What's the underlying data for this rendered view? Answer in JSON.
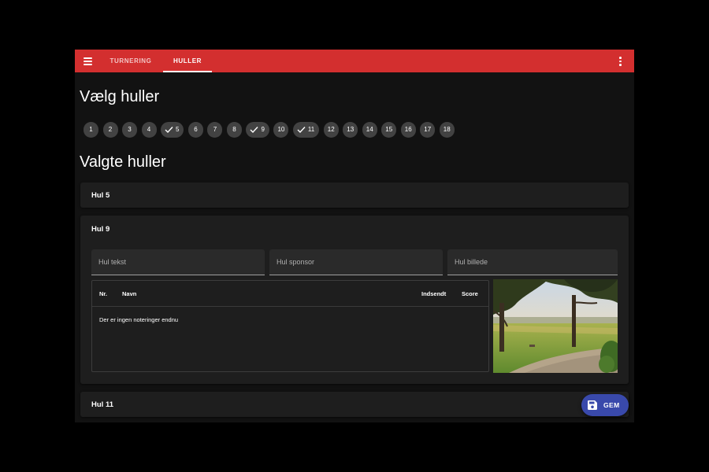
{
  "topbar": {
    "tabs": [
      {
        "label": "TURNERING",
        "active": false
      },
      {
        "label": "HULLER",
        "active": true
      }
    ],
    "menu_icon": "menu-icon",
    "more_icon": "more-vert-icon",
    "accent_color": "#d32f2f"
  },
  "select_section": {
    "title": "Vælg huller",
    "holes": [
      {
        "label": "1",
        "selected": false
      },
      {
        "label": "2",
        "selected": false
      },
      {
        "label": "3",
        "selected": false
      },
      {
        "label": "4",
        "selected": false
      },
      {
        "label": "5",
        "selected": true
      },
      {
        "label": "6",
        "selected": false
      },
      {
        "label": "7",
        "selected": false
      },
      {
        "label": "8",
        "selected": false
      },
      {
        "label": "9",
        "selected": true
      },
      {
        "label": "10",
        "selected": false
      },
      {
        "label": "11",
        "selected": true
      },
      {
        "label": "12",
        "selected": false
      },
      {
        "label": "13",
        "selected": false
      },
      {
        "label": "14",
        "selected": false
      },
      {
        "label": "15",
        "selected": false
      },
      {
        "label": "16",
        "selected": false
      },
      {
        "label": "17",
        "selected": false
      },
      {
        "label": "18",
        "selected": false
      }
    ]
  },
  "selected_section": {
    "title": "Valgte huller",
    "panels": [
      {
        "title": "Hul 5",
        "expanded": false
      },
      {
        "title": "Hul 9",
        "expanded": true,
        "fields": {
          "text_placeholder": "Hul tekst",
          "sponsor_placeholder": "Hul sponsor",
          "image_placeholder": "Hul billede"
        },
        "table": {
          "columns": [
            "Nr.",
            "Navn",
            "Indsendt",
            "Score"
          ],
          "empty_text": "Der er ingen noteringer endnu"
        }
      },
      {
        "title": "Hul 11",
        "expanded": false
      }
    ]
  },
  "fab": {
    "label": "GEM",
    "icon": "save-icon",
    "color": "#3949ab"
  }
}
